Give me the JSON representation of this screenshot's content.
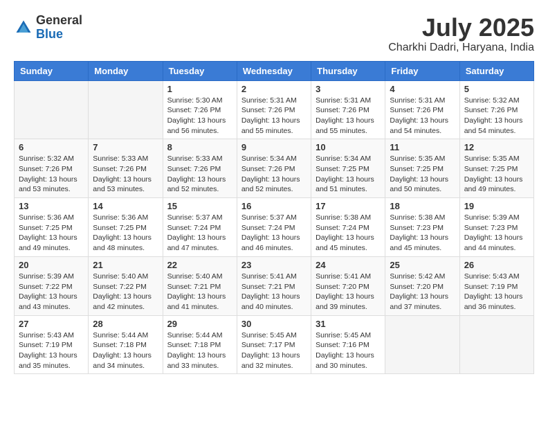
{
  "header": {
    "logo_general": "General",
    "logo_blue": "Blue",
    "month_title": "July 2025",
    "subtitle": "Charkhi Dadri, Haryana, India"
  },
  "calendar": {
    "days_of_week": [
      "Sunday",
      "Monday",
      "Tuesday",
      "Wednesday",
      "Thursday",
      "Friday",
      "Saturday"
    ],
    "weeks": [
      {
        "days": [
          {
            "number": "",
            "info": ""
          },
          {
            "number": "",
            "info": ""
          },
          {
            "number": "1",
            "info": "Sunrise: 5:30 AM\nSunset: 7:26 PM\nDaylight: 13 hours and 56 minutes."
          },
          {
            "number": "2",
            "info": "Sunrise: 5:31 AM\nSunset: 7:26 PM\nDaylight: 13 hours and 55 minutes."
          },
          {
            "number": "3",
            "info": "Sunrise: 5:31 AM\nSunset: 7:26 PM\nDaylight: 13 hours and 55 minutes."
          },
          {
            "number": "4",
            "info": "Sunrise: 5:31 AM\nSunset: 7:26 PM\nDaylight: 13 hours and 54 minutes."
          },
          {
            "number": "5",
            "info": "Sunrise: 5:32 AM\nSunset: 7:26 PM\nDaylight: 13 hours and 54 minutes."
          }
        ]
      },
      {
        "days": [
          {
            "number": "6",
            "info": "Sunrise: 5:32 AM\nSunset: 7:26 PM\nDaylight: 13 hours and 53 minutes."
          },
          {
            "number": "7",
            "info": "Sunrise: 5:33 AM\nSunset: 7:26 PM\nDaylight: 13 hours and 53 minutes."
          },
          {
            "number": "8",
            "info": "Sunrise: 5:33 AM\nSunset: 7:26 PM\nDaylight: 13 hours and 52 minutes."
          },
          {
            "number": "9",
            "info": "Sunrise: 5:34 AM\nSunset: 7:26 PM\nDaylight: 13 hours and 52 minutes."
          },
          {
            "number": "10",
            "info": "Sunrise: 5:34 AM\nSunset: 7:25 PM\nDaylight: 13 hours and 51 minutes."
          },
          {
            "number": "11",
            "info": "Sunrise: 5:35 AM\nSunset: 7:25 PM\nDaylight: 13 hours and 50 minutes."
          },
          {
            "number": "12",
            "info": "Sunrise: 5:35 AM\nSunset: 7:25 PM\nDaylight: 13 hours and 49 minutes."
          }
        ]
      },
      {
        "days": [
          {
            "number": "13",
            "info": "Sunrise: 5:36 AM\nSunset: 7:25 PM\nDaylight: 13 hours and 49 minutes."
          },
          {
            "number": "14",
            "info": "Sunrise: 5:36 AM\nSunset: 7:25 PM\nDaylight: 13 hours and 48 minutes."
          },
          {
            "number": "15",
            "info": "Sunrise: 5:37 AM\nSunset: 7:24 PM\nDaylight: 13 hours and 47 minutes."
          },
          {
            "number": "16",
            "info": "Sunrise: 5:37 AM\nSunset: 7:24 PM\nDaylight: 13 hours and 46 minutes."
          },
          {
            "number": "17",
            "info": "Sunrise: 5:38 AM\nSunset: 7:24 PM\nDaylight: 13 hours and 45 minutes."
          },
          {
            "number": "18",
            "info": "Sunrise: 5:38 AM\nSunset: 7:23 PM\nDaylight: 13 hours and 45 minutes."
          },
          {
            "number": "19",
            "info": "Sunrise: 5:39 AM\nSunset: 7:23 PM\nDaylight: 13 hours and 44 minutes."
          }
        ]
      },
      {
        "days": [
          {
            "number": "20",
            "info": "Sunrise: 5:39 AM\nSunset: 7:22 PM\nDaylight: 13 hours and 43 minutes."
          },
          {
            "number": "21",
            "info": "Sunrise: 5:40 AM\nSunset: 7:22 PM\nDaylight: 13 hours and 42 minutes."
          },
          {
            "number": "22",
            "info": "Sunrise: 5:40 AM\nSunset: 7:21 PM\nDaylight: 13 hours and 41 minutes."
          },
          {
            "number": "23",
            "info": "Sunrise: 5:41 AM\nSunset: 7:21 PM\nDaylight: 13 hours and 40 minutes."
          },
          {
            "number": "24",
            "info": "Sunrise: 5:41 AM\nSunset: 7:20 PM\nDaylight: 13 hours and 39 minutes."
          },
          {
            "number": "25",
            "info": "Sunrise: 5:42 AM\nSunset: 7:20 PM\nDaylight: 13 hours and 37 minutes."
          },
          {
            "number": "26",
            "info": "Sunrise: 5:43 AM\nSunset: 7:19 PM\nDaylight: 13 hours and 36 minutes."
          }
        ]
      },
      {
        "days": [
          {
            "number": "27",
            "info": "Sunrise: 5:43 AM\nSunset: 7:19 PM\nDaylight: 13 hours and 35 minutes."
          },
          {
            "number": "28",
            "info": "Sunrise: 5:44 AM\nSunset: 7:18 PM\nDaylight: 13 hours and 34 minutes."
          },
          {
            "number": "29",
            "info": "Sunrise: 5:44 AM\nSunset: 7:18 PM\nDaylight: 13 hours and 33 minutes."
          },
          {
            "number": "30",
            "info": "Sunrise: 5:45 AM\nSunset: 7:17 PM\nDaylight: 13 hours and 32 minutes."
          },
          {
            "number": "31",
            "info": "Sunrise: 5:45 AM\nSunset: 7:16 PM\nDaylight: 13 hours and 30 minutes."
          },
          {
            "number": "",
            "info": ""
          },
          {
            "number": "",
            "info": ""
          }
        ]
      }
    ]
  }
}
